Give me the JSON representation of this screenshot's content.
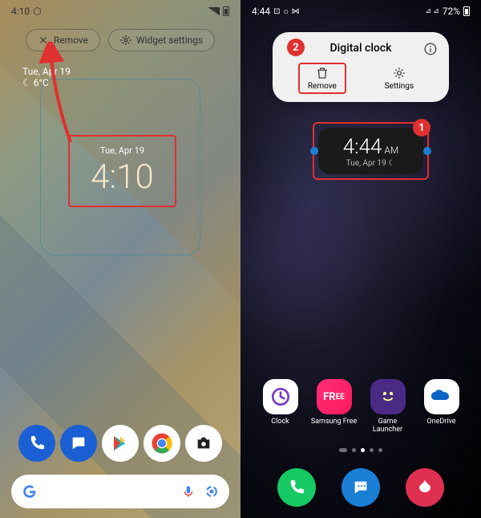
{
  "left": {
    "status": {
      "time": "4:10",
      "icons_right": "▾ ⊿ ▮"
    },
    "actions": {
      "remove": "Remove",
      "settings": "Widget settings"
    },
    "weather": {
      "date": "Tue, Apr 19",
      "cond": "☾ 6°C"
    },
    "widget": {
      "date": "Tue, Apr 19",
      "time": "4:10"
    },
    "dock": {
      "phone": "📞",
      "messages": "💬",
      "play": "▶",
      "chrome": "◉",
      "camera": "📷"
    }
  },
  "right": {
    "status": {
      "time": "4:44",
      "icons_left": "⊡ ☼ ⋈",
      "icons_right": "⊿ ⊿",
      "battery": "72%"
    },
    "menu": {
      "title": "Digital clock",
      "remove": "Remove",
      "settings": "Settings"
    },
    "widget": {
      "time": "4:44",
      "ampm": "AM",
      "date": "Tue, Apr 19 ☾"
    },
    "annotations": {
      "one": "1",
      "two": "2"
    },
    "apps": [
      {
        "label": "Clock"
      },
      {
        "label": "Samsung Free"
      },
      {
        "label": "Game Launcher"
      },
      {
        "label": "OneDrive"
      }
    ]
  }
}
